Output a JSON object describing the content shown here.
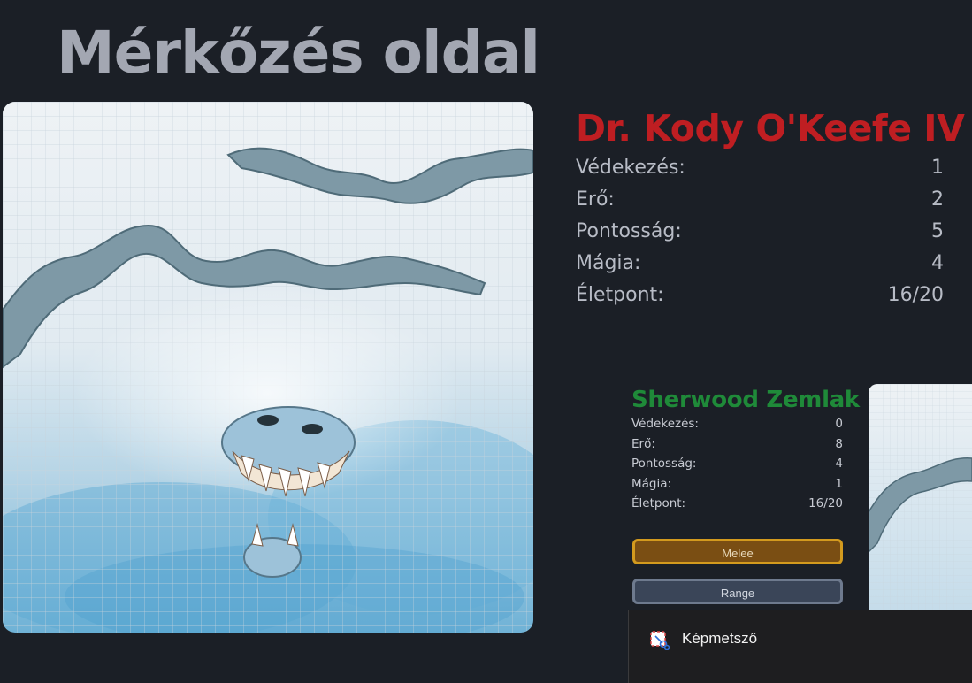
{
  "page": {
    "title": "Mérkőzés oldal"
  },
  "main_fighter": {
    "name": "Dr. Kody O'Keefe IV",
    "stats": [
      {
        "label": "Védekezés:",
        "value": "1"
      },
      {
        "label": "Erő:",
        "value": "2"
      },
      {
        "label": "Pontosság:",
        "value": "5"
      },
      {
        "label": "Mágia:",
        "value": "4"
      },
      {
        "label": "Életpont:",
        "value": "16/20"
      }
    ]
  },
  "opponent": {
    "name": "Sherwood Zemlak",
    "stats": [
      {
        "label": "Védekezés:",
        "value": "0"
      },
      {
        "label": "Erő:",
        "value": "8"
      },
      {
        "label": "Pontosság:",
        "value": "4"
      },
      {
        "label": "Mágia:",
        "value": "1"
      },
      {
        "label": "Életpont:",
        "value": "16/20"
      }
    ]
  },
  "actions": {
    "melee_label": "Melee",
    "range_label": "Range"
  },
  "colors": {
    "background": "#1b1f26",
    "main_name": "#bf1e22",
    "opponent_name": "#1f8a39",
    "melee_button": "#7a4e13",
    "melee_border": "#d39a1e",
    "range_button": "#3a4558"
  },
  "taskbar_popup": {
    "app_label": "Képmetsző",
    "icon": "snipping-tool-icon"
  }
}
